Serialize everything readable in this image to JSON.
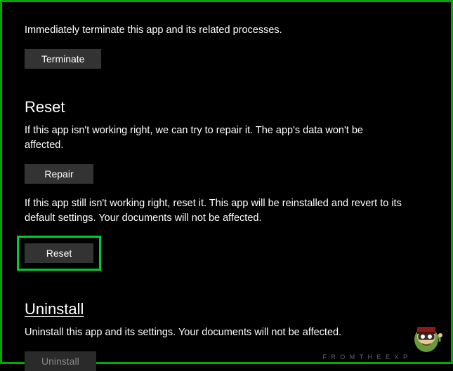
{
  "terminate": {
    "description": "Immediately terminate this app and its related processes.",
    "button": "Terminate"
  },
  "reset": {
    "heading": "Reset",
    "repair_description": "If this app isn't working right, we can try to repair it. The app's data won't be affected.",
    "repair_button": "Repair",
    "reset_description": "If this app still isn't working right, reset it. This app will be reinstalled and revert to its default settings. Your documents will not be affected.",
    "reset_button": "Reset"
  },
  "uninstall": {
    "heading": "Uninstall",
    "description": "Uninstall this app and its settings. Your documents will not be affected.",
    "button": "Uninstall"
  },
  "watermark": "F R O M   T H E   E X P"
}
